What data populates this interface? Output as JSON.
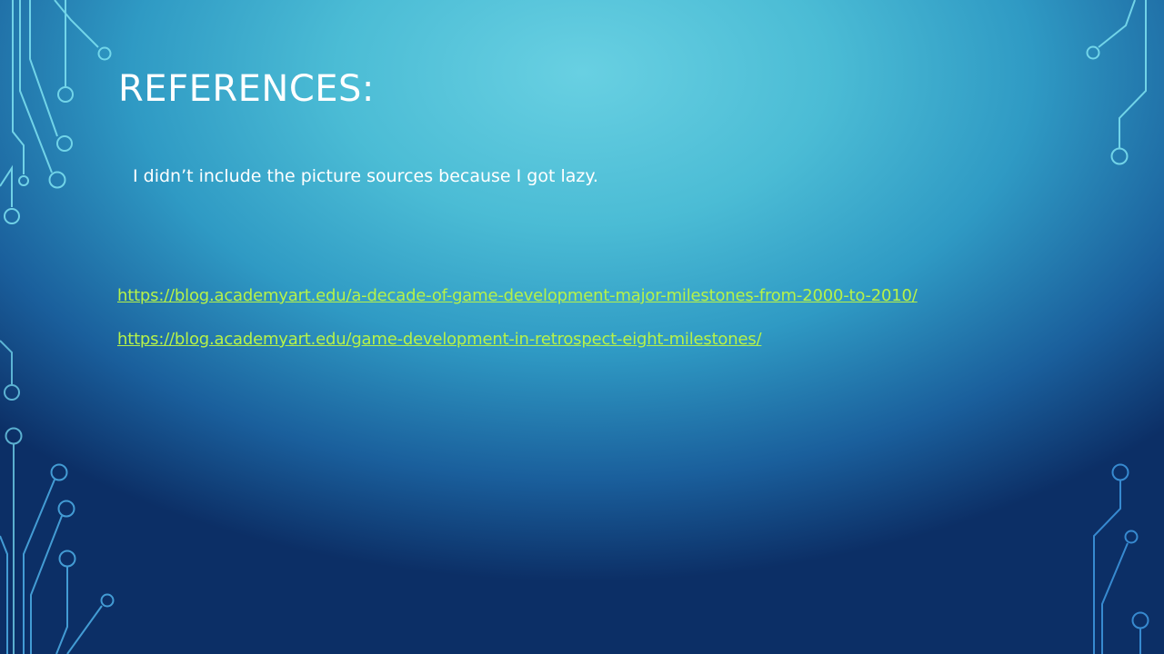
{
  "slide": {
    "title": "REFERENCES:",
    "note": "I didn’t include the picture sources because I got lazy.",
    "links": [
      "https://blog.academyart.edu/a-decade-of-game-development-major-milestones-from-2000-to-2010/",
      "https://blog.academyart.edu/game-development-in-retrospect-eight-milestones/"
    ]
  },
  "colors": {
    "title": "#ffffff",
    "link": "#b6f249",
    "circuit_light": "#7fe3f2",
    "circuit_dark": "#3a8fd6"
  },
  "icons": [
    "circuit-decoration"
  ]
}
